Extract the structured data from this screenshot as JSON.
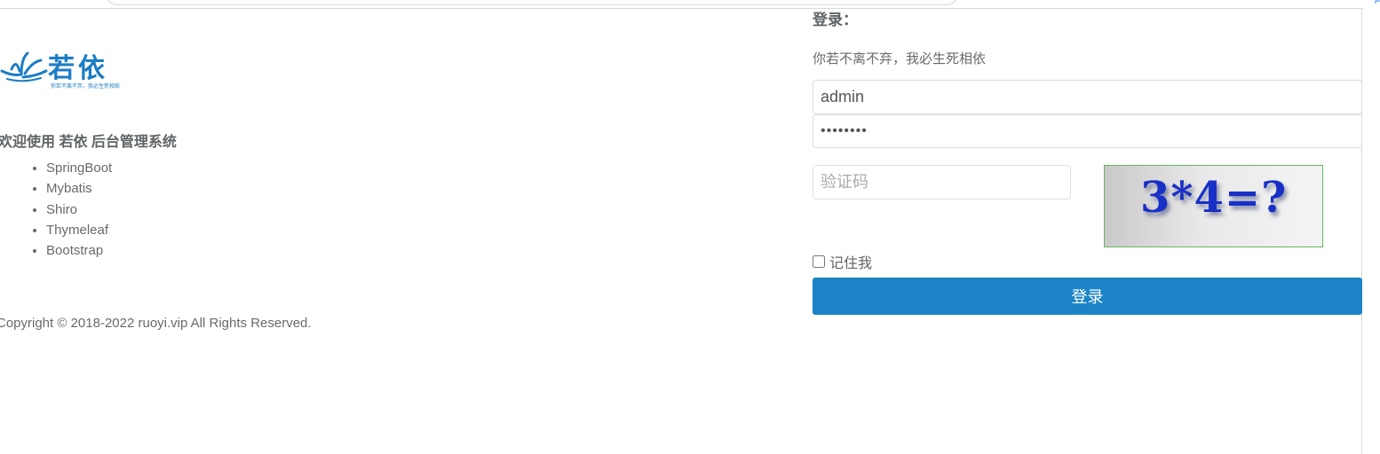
{
  "brand": {
    "name": "若依",
    "slogan": "你若不离不弃，我必生死相依",
    "color": "#1c7dc4"
  },
  "intro": {
    "welcome": "欢迎使用 若依 后台管理系统",
    "technologies": [
      "SpringBoot",
      "Mybatis",
      "Shiro",
      "Thymeleaf",
      "Bootstrap"
    ],
    "copyright": "Copyright © 2018-2022 ruoyi.vip All Rights Reserved."
  },
  "login": {
    "title": "登录：",
    "subtitle": "你若不离不弃，我必生死相依",
    "username": "admin",
    "password": "••••••••",
    "captcha_placeholder": "验证码",
    "captcha_image_text": "3*4=?",
    "remember_label": "记住我",
    "submit_label": "登录",
    "accent_color": "#1c84c6"
  }
}
